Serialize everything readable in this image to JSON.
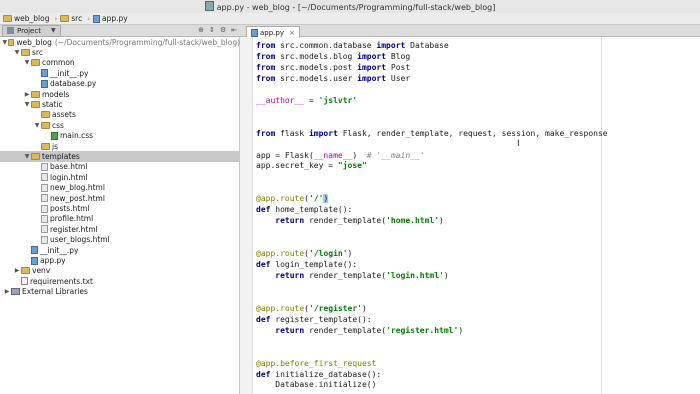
{
  "window": {
    "title": "app.py - web_blog - [~/Documents/Programming/full-stack/web_blog]"
  },
  "breadcrumbs": [
    "web_blog",
    "src",
    "app.py"
  ],
  "project_panel": {
    "label": "Project"
  },
  "tree": [
    {
      "label": "web_blog",
      "extra": "(~/Documents/Programming/full-stack/web_blog)",
      "icon": "folder",
      "arrow": "▼",
      "indent": 0,
      "selected": false
    },
    {
      "label": "src",
      "icon": "folder",
      "arrow": "▼",
      "indent": 1,
      "selected": false
    },
    {
      "label": "common",
      "icon": "folder",
      "arrow": "▼",
      "indent": 2,
      "selected": false
    },
    {
      "label": "__init__.py",
      "icon": "pyfile",
      "arrow": "",
      "indent": 3,
      "selected": false
    },
    {
      "label": "database.py",
      "icon": "pyfile",
      "arrow": "",
      "indent": 3,
      "selected": false
    },
    {
      "label": "models",
      "icon": "folder",
      "arrow": "▶",
      "indent": 2,
      "selected": false
    },
    {
      "label": "static",
      "icon": "folder",
      "arrow": "▼",
      "indent": 2,
      "selected": false
    },
    {
      "label": "assets",
      "icon": "folder",
      "arrow": "",
      "indent": 3,
      "selected": false
    },
    {
      "label": "css",
      "icon": "folder",
      "arrow": "▼",
      "indent": 3,
      "selected": false
    },
    {
      "label": "main.css",
      "icon": "cssfile",
      "arrow": "",
      "indent": 4,
      "selected": false
    },
    {
      "label": "js",
      "icon": "folder",
      "arrow": "",
      "indent": 3,
      "selected": false
    },
    {
      "label": "templates",
      "icon": "folder",
      "arrow": "▼",
      "indent": 2,
      "selected": true
    },
    {
      "label": "base.html",
      "icon": "htmlfile",
      "arrow": "",
      "indent": 3,
      "selected": false
    },
    {
      "label": "login.html",
      "icon": "htmlfile",
      "arrow": "",
      "indent": 3,
      "selected": false
    },
    {
      "label": "new_blog.html",
      "icon": "htmlfile",
      "arrow": "",
      "indent": 3,
      "selected": false
    },
    {
      "label": "new_post.html",
      "icon": "htmlfile",
      "arrow": "",
      "indent": 3,
      "selected": false
    },
    {
      "label": "posts.html",
      "icon": "htmlfile",
      "arrow": "",
      "indent": 3,
      "selected": false
    },
    {
      "label": "profile.html",
      "icon": "htmlfile",
      "arrow": "",
      "indent": 3,
      "selected": false
    },
    {
      "label": "register.html",
      "icon": "htmlfile",
      "arrow": "",
      "indent": 3,
      "selected": false
    },
    {
      "label": "user_blogs.html",
      "icon": "htmlfile",
      "arrow": "",
      "indent": 3,
      "selected": false
    },
    {
      "label": "__init__.py",
      "icon": "pyfile",
      "arrow": "",
      "indent": 2,
      "selected": false
    },
    {
      "label": "app.py",
      "icon": "pyfile",
      "arrow": "",
      "indent": 2,
      "selected": false
    },
    {
      "label": "venv",
      "icon": "folder",
      "arrow": "▶",
      "indent": 1,
      "selected": false
    },
    {
      "label": "requirements.txt",
      "icon": "txtfile",
      "arrow": "",
      "indent": 1,
      "selected": false
    },
    {
      "label": "External Libraries",
      "icon": "libico",
      "arrow": "▶",
      "indent": 0,
      "selected": false
    }
  ],
  "editor": {
    "tab_label": "app.py",
    "lines": [
      [
        {
          "t": "from",
          "c": "kw"
        },
        {
          "t": " src.common.database "
        },
        {
          "t": "import",
          "c": "kw"
        },
        {
          "t": " Database"
        }
      ],
      [
        {
          "t": "from",
          "c": "kw"
        },
        {
          "t": " src.models.blog "
        },
        {
          "t": "import",
          "c": "kw"
        },
        {
          "t": " Blog"
        }
      ],
      [
        {
          "t": "from",
          "c": "kw"
        },
        {
          "t": " src.models.post "
        },
        {
          "t": "import",
          "c": "kw"
        },
        {
          "t": " Post"
        }
      ],
      [
        {
          "t": "from",
          "c": "kw"
        },
        {
          "t": " src.models.user "
        },
        {
          "t": "import",
          "c": "kw"
        },
        {
          "t": " User"
        }
      ],
      [],
      [
        {
          "t": "__author__",
          "c": "mag"
        },
        {
          "t": " = "
        },
        {
          "t": "'jslvtr'",
          "c": "str"
        }
      ],
      [],
      [],
      [
        {
          "t": "from",
          "c": "kw"
        },
        {
          "t": " flask "
        },
        {
          "t": "import",
          "c": "kw"
        },
        {
          "t": " Flask, render_template, request, session, make_response"
        }
      ],
      [],
      [
        {
          "t": "app = Flask("
        },
        {
          "t": "__name__",
          "c": "mag"
        },
        {
          "t": ")  "
        },
        {
          "t": "# '__main__'",
          "c": "cmt"
        }
      ],
      [
        {
          "t": "app.secret_key = "
        },
        {
          "t": "\"jose\"",
          "c": "str"
        }
      ],
      [],
      [],
      [
        {
          "t": "@app.route",
          "c": "dec"
        },
        {
          "t": "("
        },
        {
          "t": "'/'",
          "c": "str"
        },
        {
          "t": ")",
          "c": "hl"
        }
      ],
      [
        {
          "t": "def",
          "c": "kw"
        },
        {
          "t": " home_template():"
        }
      ],
      [
        {
          "t": "    "
        },
        {
          "t": "return",
          "c": "kw"
        },
        {
          "t": " render_template("
        },
        {
          "t": "'home.html'",
          "c": "str"
        },
        {
          "t": ")"
        }
      ],
      [],
      [],
      [
        {
          "t": "@app.route",
          "c": "dec"
        },
        {
          "t": "("
        },
        {
          "t": "'/login'",
          "c": "str"
        },
        {
          "t": ")"
        }
      ],
      [
        {
          "t": "def",
          "c": "kw"
        },
        {
          "t": " login_template():"
        }
      ],
      [
        {
          "t": "    "
        },
        {
          "t": "return",
          "c": "kw"
        },
        {
          "t": " render_template("
        },
        {
          "t": "'login.html'",
          "c": "str"
        },
        {
          "t": ")"
        }
      ],
      [],
      [],
      [
        {
          "t": "@app.route",
          "c": "dec"
        },
        {
          "t": "("
        },
        {
          "t": "'/register'",
          "c": "str"
        },
        {
          "t": ")"
        }
      ],
      [
        {
          "t": "def",
          "c": "kw"
        },
        {
          "t": " register_template():"
        }
      ],
      [
        {
          "t": "    "
        },
        {
          "t": "return",
          "c": "kw"
        },
        {
          "t": " render_template("
        },
        {
          "t": "'register.html'",
          "c": "str"
        },
        {
          "t": ")"
        }
      ],
      [],
      [],
      [
        {
          "t": "@app.before_first_request",
          "c": "dec"
        }
      ],
      [
        {
          "t": "def",
          "c": "kw"
        },
        {
          "t": " initialize_database():"
        }
      ],
      [
        {
          "t": "    Database.initialize()"
        }
      ]
    ]
  }
}
